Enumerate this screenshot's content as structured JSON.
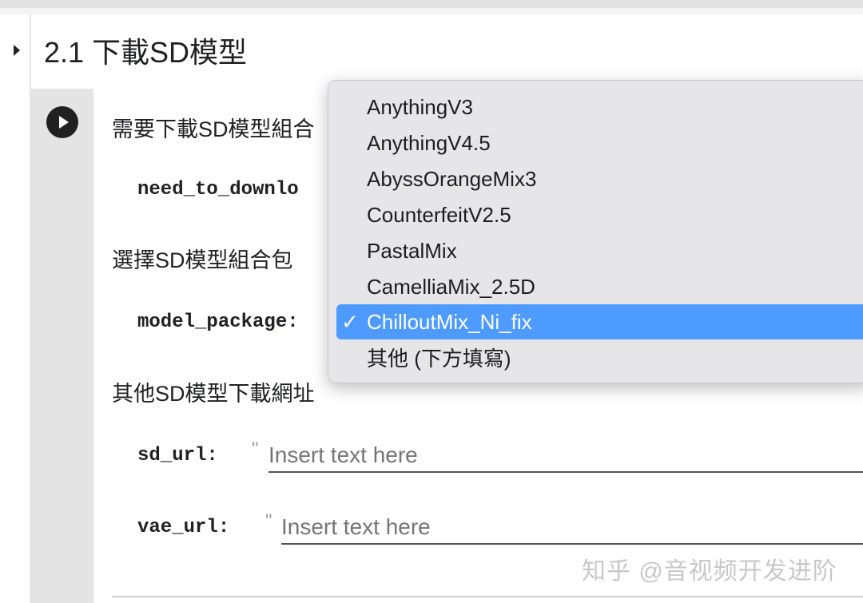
{
  "section": {
    "title": "2.1 下載SD模型"
  },
  "form": {
    "need_to_download_description": "需要下載SD模型組合",
    "need_to_download_param": "need_to_downlo",
    "model_package_description": "選擇SD模型組合包",
    "model_package_param": "model_package:",
    "other_url_description": "其他SD模型下載網址",
    "sd_url_param": "sd_url:",
    "sd_url_placeholder": "Insert text here",
    "vae_url_param": "vae_url:",
    "vae_url_placeholder": "Insert text here",
    "quote_mark": "\""
  },
  "dropdown": {
    "selected_value": "ChilloutMix_Ni_fix",
    "check_mark": "✓",
    "options": [
      "AnythingV3",
      "AnythingV4.5",
      "AbyssOrangeMix3",
      "CounterfeitV2.5",
      "PastalMix",
      "CamelliaMix_2.5D",
      "ChilloutMix_Ni_fix",
      "其他 (下方填寫)"
    ]
  },
  "watermark": "知乎 @音视频开发进阶",
  "icons": {
    "run": "play-circle-icon",
    "collapse": "triangle-right-icon",
    "check": "checkmark-icon"
  },
  "colors": {
    "selection": "#4e9bff",
    "cell_gutter": "#e4e4e4",
    "dropdown_bg": "#e6e6e9"
  }
}
